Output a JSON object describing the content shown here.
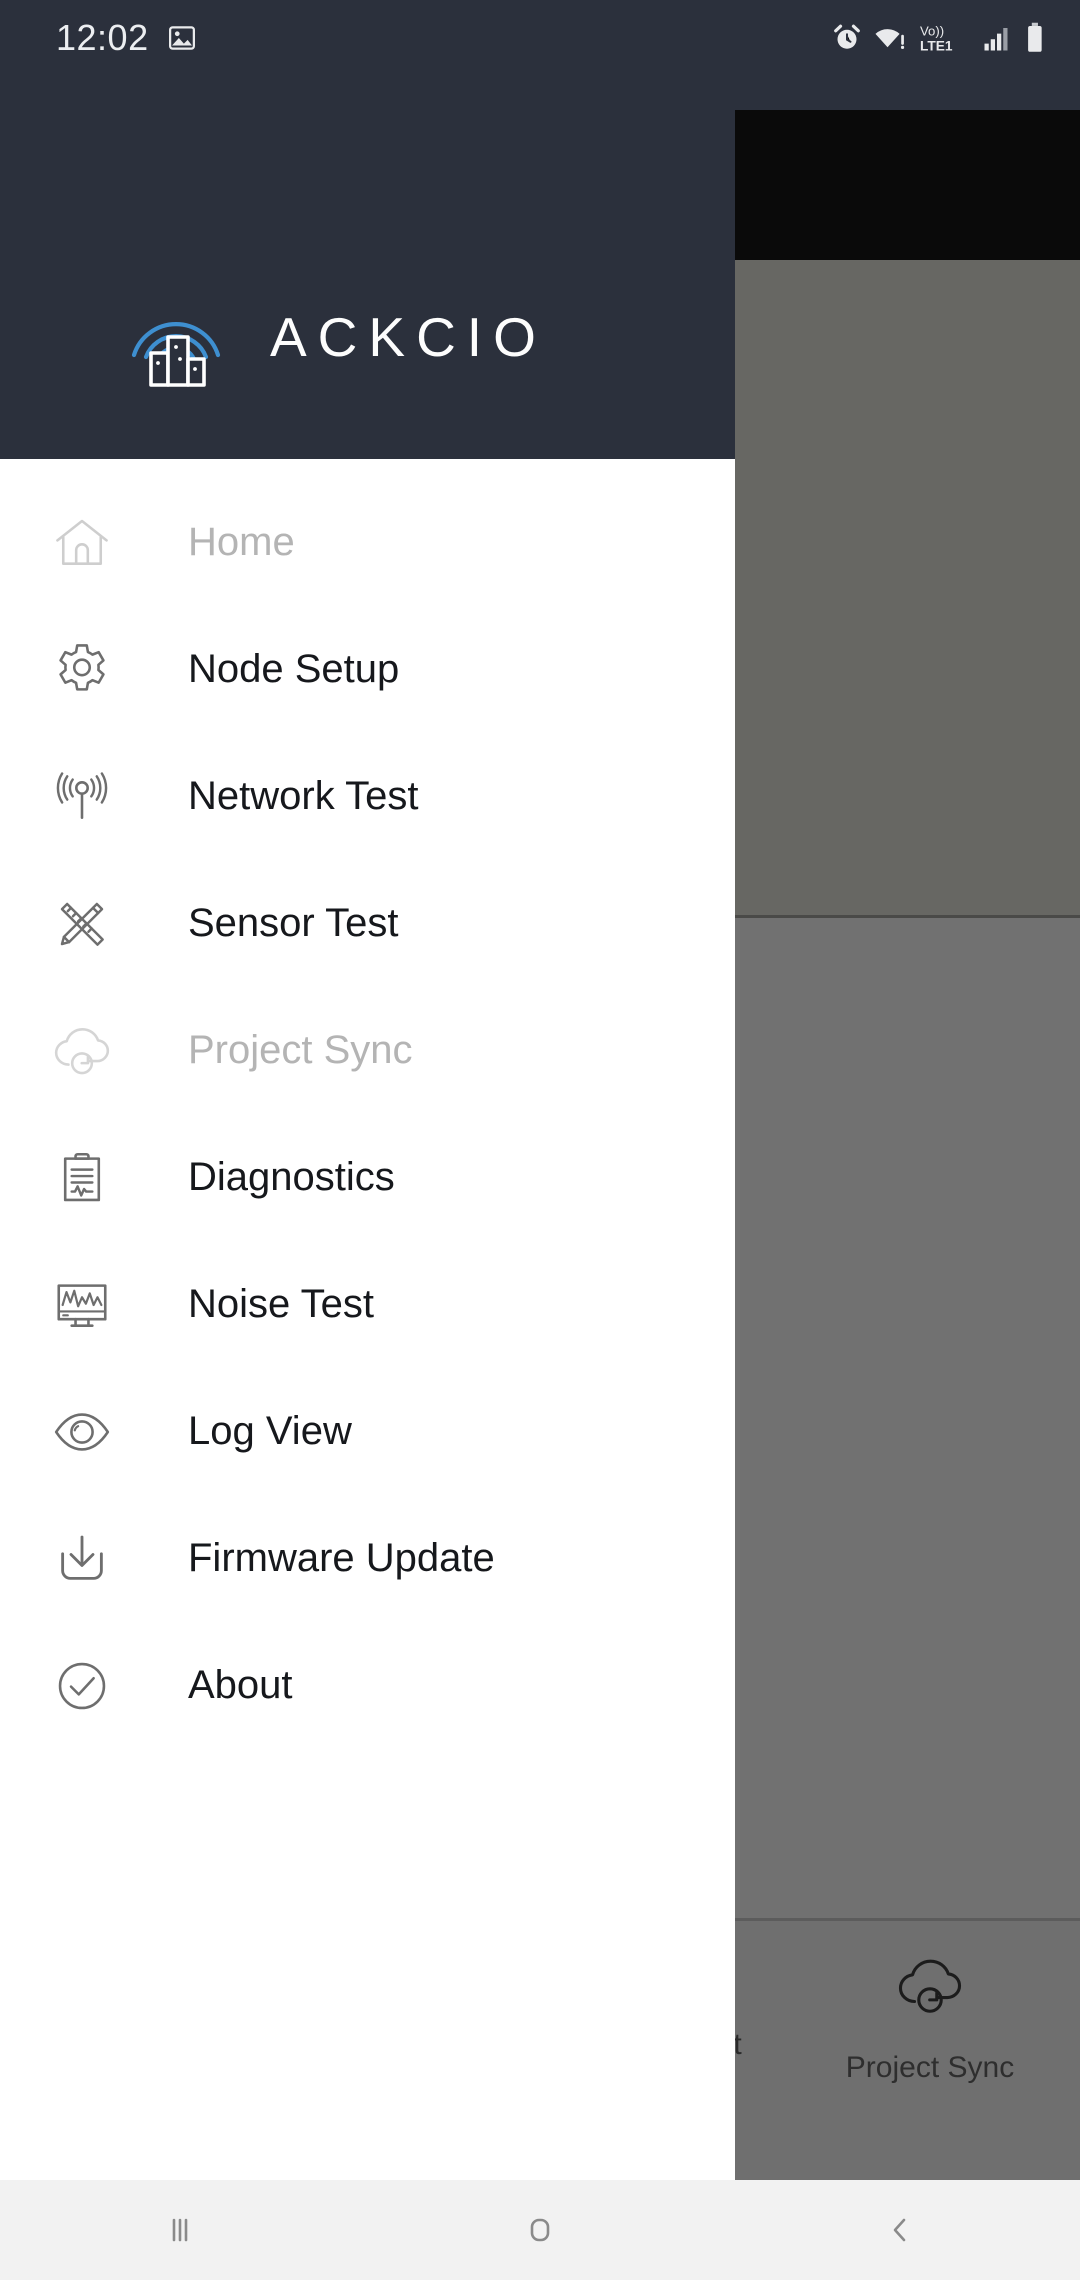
{
  "status_bar": {
    "clock": "12:02",
    "left_icons": [
      "image-icon"
    ],
    "right_icons": [
      "alarm-icon",
      "wifi-warning-icon",
      "volte-lte1-icon",
      "signal-bars-icon",
      "battery-icon"
    ],
    "volte_label": "Vo))",
    "network_label": "LTE1"
  },
  "drawer": {
    "brand": {
      "name": "ACKCIO",
      "logo_icon": "ackcio-signal-buildings-logo",
      "logo_accent_color": "#3e8fd0",
      "text_color": "#fdfdfd",
      "header_bg": "#2b303c"
    },
    "items": [
      {
        "label": "Home",
        "icon": "home-icon",
        "enabled": false
      },
      {
        "label": "Node Setup",
        "icon": "gear-icon",
        "enabled": true
      },
      {
        "label": "Network Test",
        "icon": "antenna-signal-icon",
        "enabled": true
      },
      {
        "label": "Sensor Test",
        "icon": "ruler-pencil-icon",
        "enabled": true
      },
      {
        "label": "Project Sync",
        "icon": "cloud-sync-icon",
        "enabled": false
      },
      {
        "label": "Diagnostics",
        "icon": "clipboard-pulse-icon",
        "enabled": true
      },
      {
        "label": "Noise Test",
        "icon": "monitor-waveform-icon",
        "enabled": true
      },
      {
        "label": "Log View",
        "icon": "eye-icon",
        "enabled": true
      },
      {
        "label": "Firmware Update",
        "icon": "download-tray-icon",
        "enabled": true
      },
      {
        "label": "About",
        "icon": "check-circle-icon",
        "enabled": true
      }
    ]
  },
  "background_app": {
    "bottom_nav": {
      "visible_item": {
        "label": "Project Sync",
        "icon": "cloud-sync-icon"
      },
      "partial_item": {
        "label": "st"
      }
    }
  },
  "system_nav": {
    "recents_label": "recents-icon",
    "home_label": "home-square-icon",
    "back_label": "back-chevron-icon"
  }
}
